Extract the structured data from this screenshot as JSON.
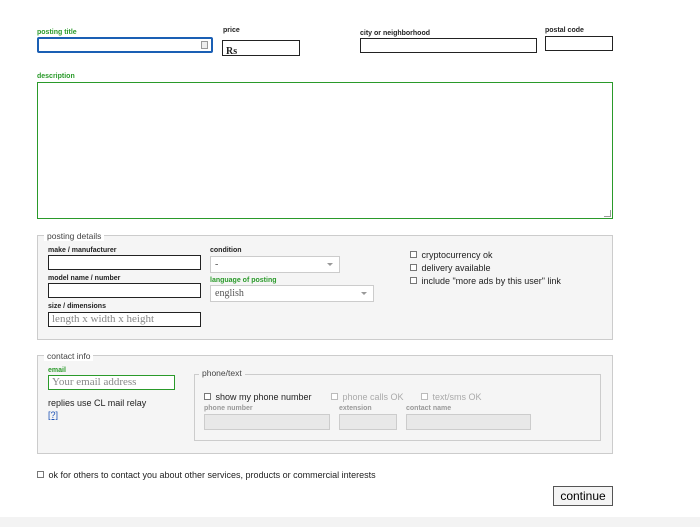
{
  "top_fields": {
    "posting_title_label": "posting title",
    "price_label": "price",
    "price_value": "Rs",
    "city_label": "city or neighborhood",
    "postal_label": "postal code"
  },
  "description": {
    "label": "description"
  },
  "posting_details": {
    "legend": "posting details",
    "make_label": "make / manufacturer",
    "model_label": "model name / number",
    "size_label": "size / dimensions",
    "size_placeholder": "length x width x height",
    "condition_label": "condition",
    "condition_value": "-",
    "language_label": "language of posting",
    "language_value": "english",
    "checkboxes": [
      "cryptocurrency ok",
      "delivery available",
      "include \"more ads by this user\" link"
    ]
  },
  "contact_info": {
    "legend": "contact info",
    "email_label": "email",
    "email_placeholder": "Your email address",
    "relay_text": "replies use CL mail relay",
    "help_link": "[?]",
    "phone_legend": "phone/text",
    "show_phone": "show my phone number",
    "phone_calls": "phone calls OK",
    "text_sms": "text/sms OK",
    "phone_number_label": "phone number",
    "extension_label": "extension",
    "contact_name_label": "contact name"
  },
  "consent": {
    "text": "ok for others to contact you about other services, products or commercial interests"
  },
  "actions": {
    "continue_label": "continue"
  },
  "colors": {
    "accent_green": "#2a9a2a",
    "focus_blue": "#1a5fb4"
  }
}
